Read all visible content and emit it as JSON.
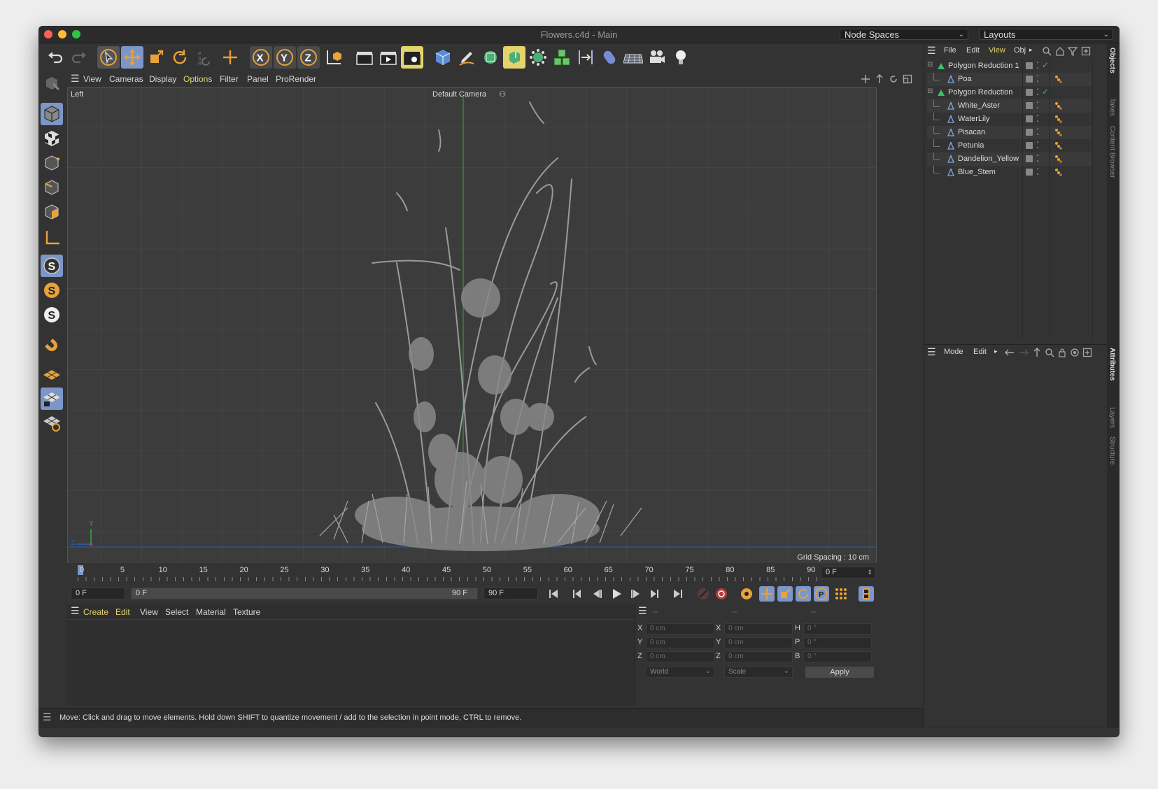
{
  "window": {
    "title": "Flowers.c4d - Main",
    "node_spaces": "Node Spaces",
    "layouts": "Layouts"
  },
  "viewport_menu": [
    "View",
    "Cameras",
    "Display",
    "Options",
    "Filter",
    "Panel",
    "ProRender"
  ],
  "viewport": {
    "view_name": "Left",
    "camera": "Default Camera",
    "grid_spacing": "Grid Spacing : 10 cm",
    "axis_y": "Y",
    "axis_z": "Z"
  },
  "timeline": {
    "ticks": [
      "0",
      "5",
      "10",
      "15",
      "20",
      "25",
      "30",
      "35",
      "40",
      "45",
      "50",
      "55",
      "60",
      "65",
      "70",
      "75",
      "80",
      "85",
      "90"
    ],
    "current_frame": "0 F"
  },
  "transport": {
    "start": "0 F",
    "range_start": "0 F",
    "range_end": "90 F",
    "end": "90 F"
  },
  "material_menu": [
    "Create",
    "Edit",
    "View",
    "Select",
    "Material",
    "Texture"
  ],
  "coords": {
    "headers": [
      "--",
      "--",
      "--"
    ],
    "rows": [
      {
        "l1": "X",
        "v1": "0 cm",
        "l2": "X",
        "v2": "0 cm",
        "l3": "H",
        "v3": "0 °"
      },
      {
        "l1": "Y",
        "v1": "0 cm",
        "l2": "Y",
        "v2": "0 cm",
        "l3": "P",
        "v3": "0 °"
      },
      {
        "l1": "Z",
        "v1": "0 cm",
        "l2": "Z",
        "v2": "0 cm",
        "l3": "B",
        "v3": "0 °"
      }
    ],
    "space": "World",
    "mode": "Scale",
    "apply": "Apply"
  },
  "status": "Move: Click and drag to move elements. Hold down SHIFT to quantize movement / add to the selection in point mode, CTRL to remove.",
  "objects_menu": [
    "File",
    "Edit",
    "View",
    "Obj"
  ],
  "objects": [
    {
      "name": "Polygon Reduction 1",
      "type": "reduction",
      "level": 0
    },
    {
      "name": "Poa",
      "type": "mesh",
      "level": 1
    },
    {
      "name": "Polygon Reduction",
      "type": "reduction",
      "level": 0
    },
    {
      "name": "White_Aster",
      "type": "mesh",
      "level": 1
    },
    {
      "name": "WaterLily",
      "type": "mesh",
      "level": 1
    },
    {
      "name": "Pisacan",
      "type": "mesh",
      "level": 1
    },
    {
      "name": "Petunia",
      "type": "mesh",
      "level": 1
    },
    {
      "name": "Dandelion_Yellow",
      "type": "mesh",
      "level": 1
    },
    {
      "name": "Blue_Stem",
      "type": "mesh",
      "level": 1
    }
  ],
  "attributes_menu": [
    "Mode",
    "Edit"
  ],
  "right_tabs_top": [
    "Objects",
    "Takes",
    "Content Browser"
  ],
  "right_tabs_bottom": [
    "Attributes",
    "Layers",
    "Structure"
  ],
  "colors": {
    "accent": "#e8a23a",
    "active_menu": "#e3d56b",
    "active_btn": "#7d96c8"
  }
}
